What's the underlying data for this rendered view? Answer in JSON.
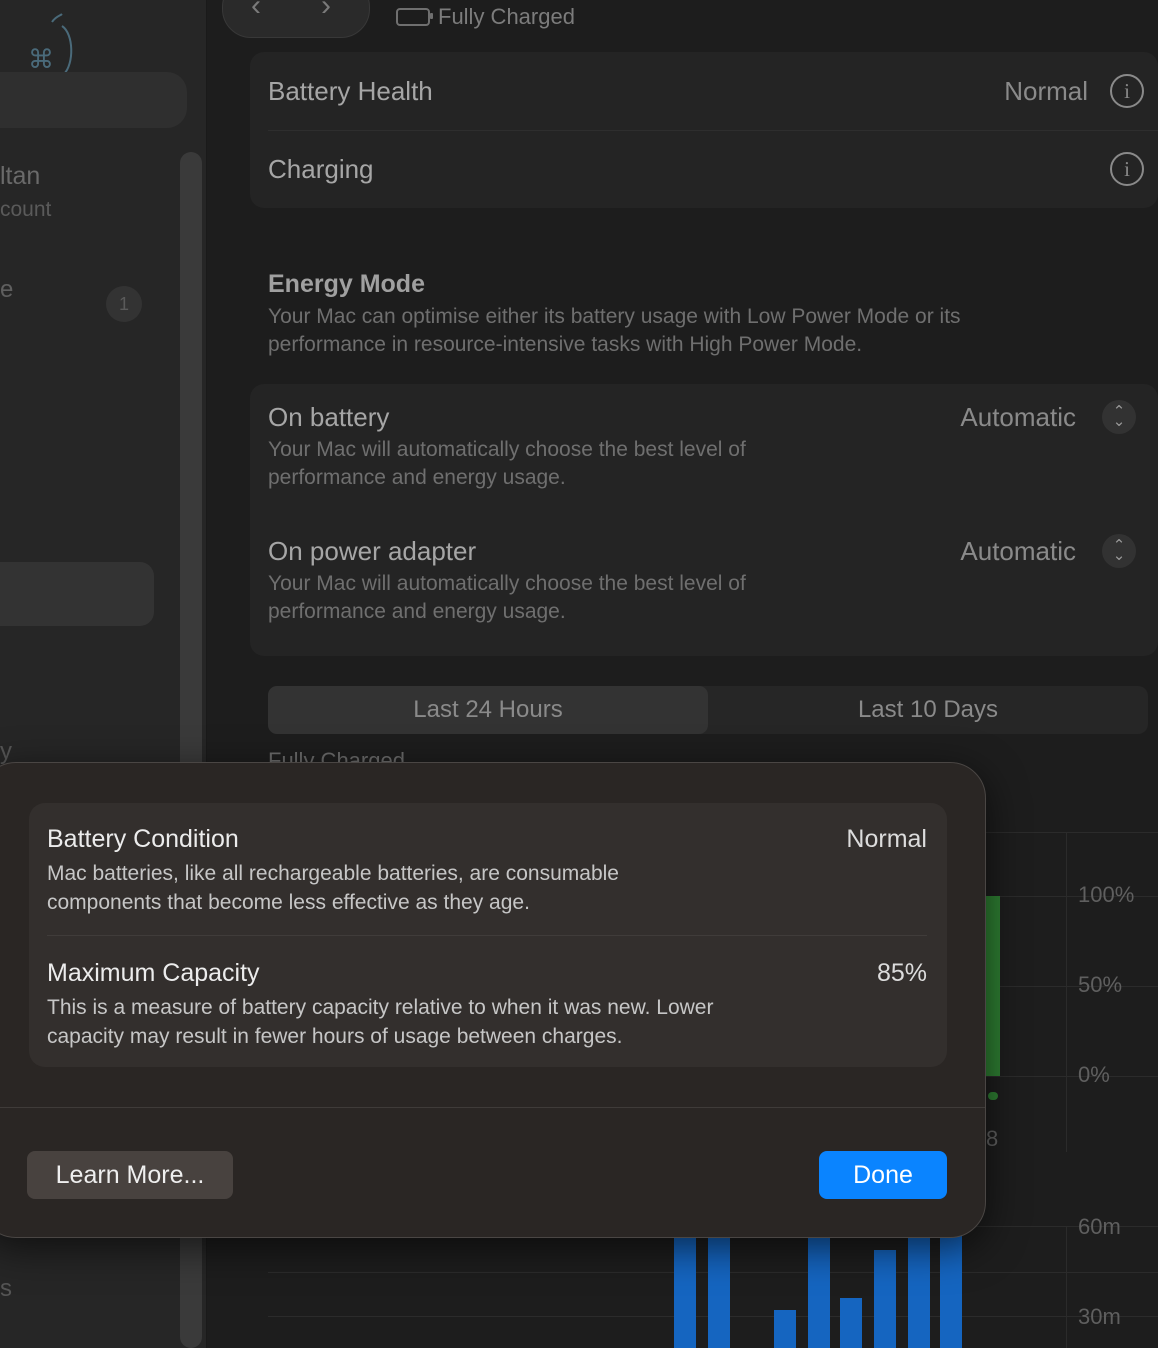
{
  "header": {
    "status_text": "Fully Charged",
    "battery_icon": "battery-charging-icon"
  },
  "battery_rows": [
    {
      "label": "Battery Health",
      "value": "Normal"
    },
    {
      "label": "Charging",
      "value": ""
    }
  ],
  "energy_mode": {
    "title": "Energy Mode",
    "description_line1": "Your Mac can optimise either its battery usage with Low Power Mode or its",
    "description_line2": "performance in resource-intensive tasks with High Power Mode.",
    "rows": [
      {
        "label": "On battery",
        "value": "Automatic",
        "desc_line1": "Your Mac will automatically choose the best level of",
        "desc_line2": "performance and energy usage."
      },
      {
        "label": "On power adapter",
        "value": "Automatic",
        "desc_line1": "Your Mac will automatically choose the best level of",
        "desc_line2": "performance and energy usage."
      }
    ]
  },
  "usage_tabs": {
    "tab1": "Last 24 Hours",
    "tab2": "Last 10 Days",
    "selected": "Last 24 Hours"
  },
  "chart_data": {
    "type": "bar",
    "battery_level_axis": [
      "100%",
      "50%",
      "0%"
    ],
    "usage_axis": [
      "60m",
      "30m"
    ],
    "x_tick_partial": "8",
    "partially_hidden_label": "Fully Charged"
  },
  "sidebar": {
    "user_name_partial": "ltan",
    "user_sub_partial": "count",
    "item_partial_1": "e",
    "badge_count": "1",
    "item_partial_2": "y",
    "item_partial_3": "s"
  },
  "sheet": {
    "rows": [
      {
        "title": "Battery Condition",
        "value": "Normal",
        "desc_line1": "Mac batteries, like all rechargeable batteries, are consumable",
        "desc_line2": "components that become less effective as they age."
      },
      {
        "title": "Maximum Capacity",
        "value": "85%",
        "desc_line1": "This is a measure of battery capacity relative to when it was new. Lower",
        "desc_line2": "capacity may result in fewer hours of usage between charges."
      }
    ],
    "learn_more_label": "Learn More...",
    "done_label": "Done"
  },
  "colors": {
    "accent": "#0a84ff",
    "battery_bar": "#2e7d32",
    "usage_bar": "#1565c0"
  }
}
